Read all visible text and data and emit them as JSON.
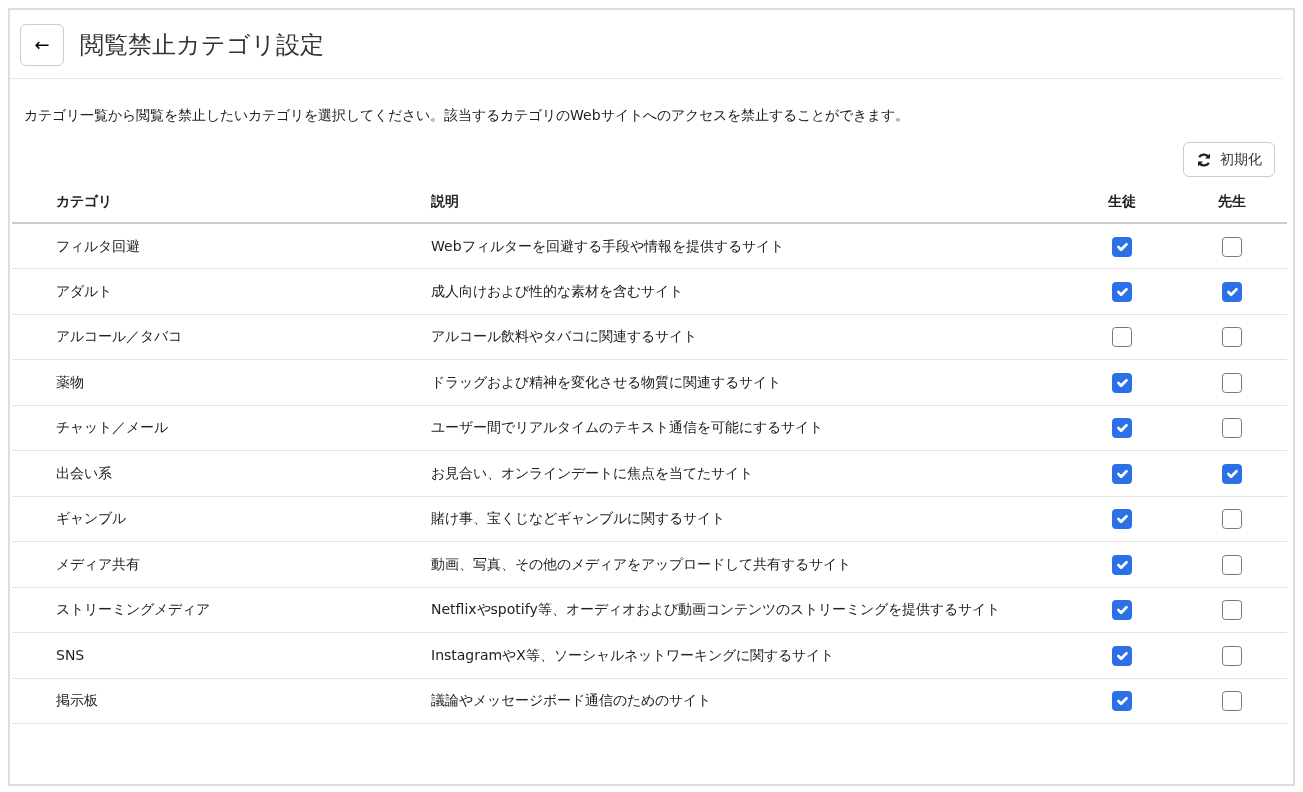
{
  "header": {
    "back_button": "←",
    "title": "閲覧禁止カテゴリ設定"
  },
  "description": "カテゴリ一覧から閲覧を禁止したいカテゴリを選択してください。該当するカテゴリのWebサイトへのアクセスを禁止することができます。",
  "reset_button": {
    "label": "初期化"
  },
  "table": {
    "columns": [
      "カテゴリ",
      "説明",
      "生徒",
      "先生"
    ],
    "rows": [
      {
        "category": "フィルタ回避",
        "description": "Webフィルターを回避する手段や情報を提供するサイト",
        "student": true,
        "teacher": false
      },
      {
        "category": "アダルト",
        "description": "成人向けおよび性的な素材を含むサイト",
        "student": true,
        "teacher": true
      },
      {
        "category": "アルコール／タバコ",
        "description": "アルコール飲料やタバコに関連するサイト",
        "student": false,
        "teacher": false
      },
      {
        "category": "薬物",
        "description": "ドラッグおよび精神を変化させる物質に関連するサイト",
        "student": true,
        "teacher": false
      },
      {
        "category": "チャット／メール",
        "description": "ユーザー間でリアルタイムのテキスト通信を可能にするサイト",
        "student": true,
        "teacher": false
      },
      {
        "category": "出会い系",
        "description": "お見合い、オンラインデートに焦点を当てたサイト",
        "student": true,
        "teacher": true
      },
      {
        "category": "ギャンブル",
        "description": "賭け事、宝くじなどギャンブルに関するサイト",
        "student": true,
        "teacher": false
      },
      {
        "category": "メディア共有",
        "description": "動画、写真、その他のメディアをアップロードして共有するサイト",
        "student": true,
        "teacher": false
      },
      {
        "category": "ストリーミングメディア",
        "description": "Netflixやspotify等、オーディオおよび動画コンテンツのストリーミングを提供するサイト",
        "student": true,
        "teacher": false
      },
      {
        "category": "SNS",
        "description": "InstagramやX等、ソーシャルネットワーキングに関するサイト",
        "student": true,
        "teacher": false
      },
      {
        "category": "掲示板",
        "description": "議論やメッセージボード通信のためのサイト",
        "student": true,
        "teacher": false
      }
    ]
  }
}
